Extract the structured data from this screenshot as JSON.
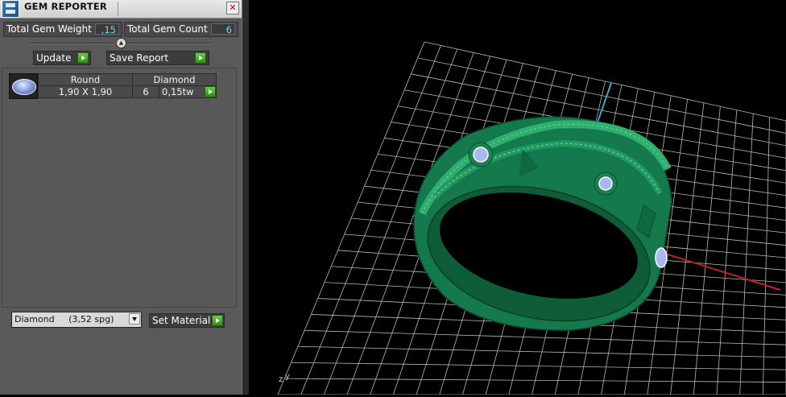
{
  "panel": {
    "title": "GEM REPORTER",
    "close_icon": "close-icon",
    "total_weight": {
      "label": "Total Gem Weight",
      "value": ",15"
    },
    "total_count": {
      "label": "Total Gem Count",
      "value": "6"
    },
    "update_label": "Update",
    "save_label": "Save Report",
    "gem_row": {
      "shape": "Round",
      "material": "Diamond",
      "size": "1,90 X 1,90",
      "count": "6",
      "weight": "0,15tw"
    },
    "material_select": "Diamond     (3,52 spg)",
    "set_material_label": "Set Material"
  },
  "viewport": {
    "axis_z": "z",
    "axis_y": "y",
    "model_color": "#19895a",
    "grid_color": "#b8b8b8"
  }
}
